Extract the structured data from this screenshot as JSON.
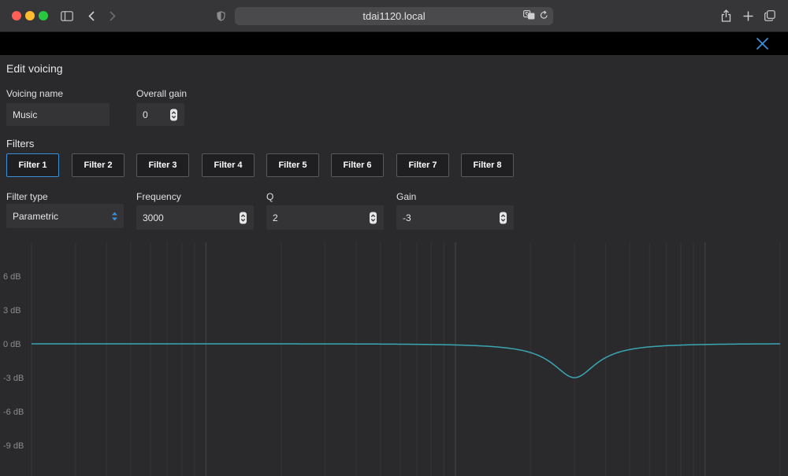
{
  "browser": {
    "url": "tdai1120.local",
    "colors": {
      "chrome_bg": "#363638",
      "url_bg": "#4a4a4c"
    }
  },
  "page": {
    "title": "Edit voicing",
    "accent_color": "#3a8fd6",
    "curve_color": "#3aa6b3"
  },
  "voicing": {
    "name_label": "Voicing name",
    "name_value": "Music",
    "gain_label": "Overall gain",
    "gain_value": "0"
  },
  "filters": {
    "title": "Filters",
    "tabs": [
      "Filter 1",
      "Filter 2",
      "Filter 3",
      "Filter 4",
      "Filter 5",
      "Filter 6",
      "Filter 7",
      "Filter 8"
    ],
    "active_index": 0
  },
  "filter_settings": {
    "type_label": "Filter type",
    "type_value": "Parametric",
    "frequency_label": "Frequency",
    "frequency_value": "3000",
    "q_label": "Q",
    "q_value": "2",
    "gain_label": "Gain",
    "gain_value": "-3"
  },
  "chart_data": {
    "type": "line",
    "y_ticks": [
      "6 dB",
      "3 dB",
      "0 dB",
      "-3 dB",
      "-6 dB",
      "-9 dB"
    ],
    "y_values": [
      6,
      3,
      0,
      -3,
      -6,
      -9
    ],
    "x_scale": "log",
    "xlim": [
      20,
      20000
    ],
    "grid": true,
    "series": [
      {
        "filter": "parametric",
        "center_frequency_hz": 3000,
        "q": 2,
        "gain_db": -3
      }
    ]
  }
}
